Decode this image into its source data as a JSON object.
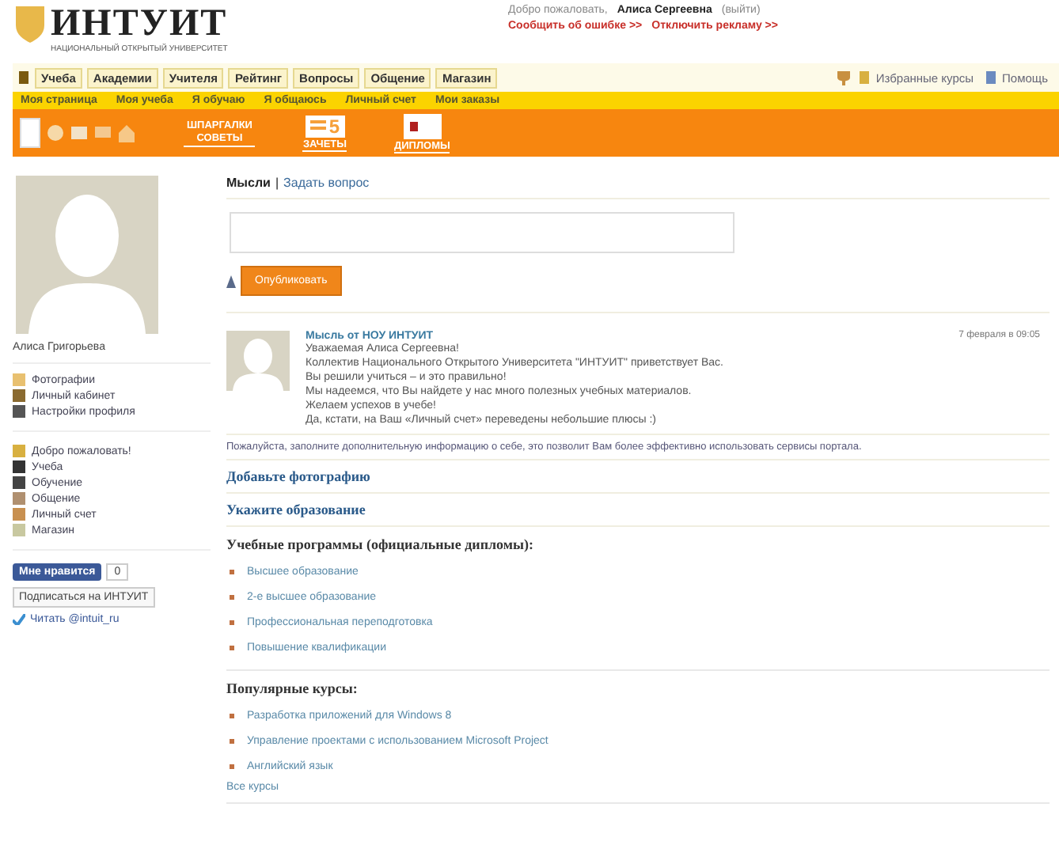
{
  "header": {
    "logo": "ИНТУИТ",
    "logo_subtitle": "НАЦИОНАЛЬНЫЙ ОТКРЫТЫЙ УНИВЕРСИТЕТ",
    "welcome": "Добро пожаловать,",
    "user": "Алиса Сергеевна",
    "logout": "(выйти)",
    "links": [
      "Сообщить об ошибке >>",
      "Отключить рекламу >>"
    ]
  },
  "tabs": [
    "Учеба",
    "Академии",
    "Учителя",
    "Рейтинг",
    "Вопросы",
    "Общение",
    "Магазин"
  ],
  "top_links": [
    "Избранные курсы",
    "Помощь"
  ],
  "subnav": [
    "Моя страница",
    "Моя учеба",
    "Я обучаю",
    "Я общаюсь",
    "Личный счет",
    "Мои заказы"
  ],
  "promo": [
    {
      "kind": "text",
      "lines": [
        "ШПАРГАЛКИ",
        "СОВЕТЫ"
      ]
    },
    {
      "kind": "counter",
      "number": "5",
      "label": "ЗАЧЕТЫ"
    },
    {
      "kind": "diploma",
      "label": "ДИПЛОМЫ"
    }
  ],
  "sidebar": {
    "name": "Алиса Григорьева",
    "profile_links": [
      {
        "label": "Фотографии",
        "color": "#e8c070"
      },
      {
        "label": "Личный кабинет",
        "color": "#8a6a30"
      },
      {
        "label": "Настройки профиля",
        "color": "#555555"
      }
    ],
    "menu": [
      {
        "label": "Добро пожаловать!",
        "color": "#d8b040"
      },
      {
        "label": "Учеба",
        "color": "#333333"
      },
      {
        "label": "Обучение",
        "color": "#444444"
      },
      {
        "label": "Общение",
        "color": "#b09070"
      },
      {
        "label": "Личный счет",
        "color": "#c89050"
      },
      {
        "label": "Магазин",
        "color": "#c8c8a0"
      }
    ],
    "like": "Мне нравится",
    "like_count": "0",
    "subscribe": "Подписаться на ИНТУИТ",
    "twitter": "Читать @intuit_ru"
  },
  "composer": {
    "separator": "|",
    "tabs": [
      {
        "label": "Мысли",
        "selected": true
      },
      {
        "label": "Задать вопрос",
        "selected": false
      }
    ],
    "button": "Опубликовать"
  },
  "post": {
    "author": "Мысль от НОУ ИНТУИТ",
    "date": "7 февраля в 09:05",
    "lines": [
      "Уважаемая Алиса Сергеевна!",
      "Коллектив Национального Открытого Университета \"ИНТУИТ\" приветствует Вас.",
      "Вы решили учиться – и это правильно!",
      "Мы надеемся, что Вы найдете у нас много полезных учебных материалов.",
      "Желаем успехов в учебе!",
      "Да, кстати, на Ваш «Личный счет» переведены небольшие плюсы :)"
    ]
  },
  "notice": "Пожалуйста, заполните дополнительную информацию о себе, это позволит Вам более эффективно использовать сервисы портала.",
  "actions": [
    "Добавьте фотографию",
    "Укажите образование"
  ],
  "sections": [
    {
      "title": "Учебные программы (официальные дипломы):",
      "items": [
        "Высшее образование",
        "2-е высшее образование",
        "Профессиональная переподготовка",
        "Повышение квалификации"
      ]
    },
    {
      "title": "Популярные курсы:",
      "items": [
        "Разработка приложений для Windows 8",
        "Управление проектами с использованием Microsoft Project",
        "Английский язык"
      ],
      "more": "Все курсы"
    }
  ]
}
